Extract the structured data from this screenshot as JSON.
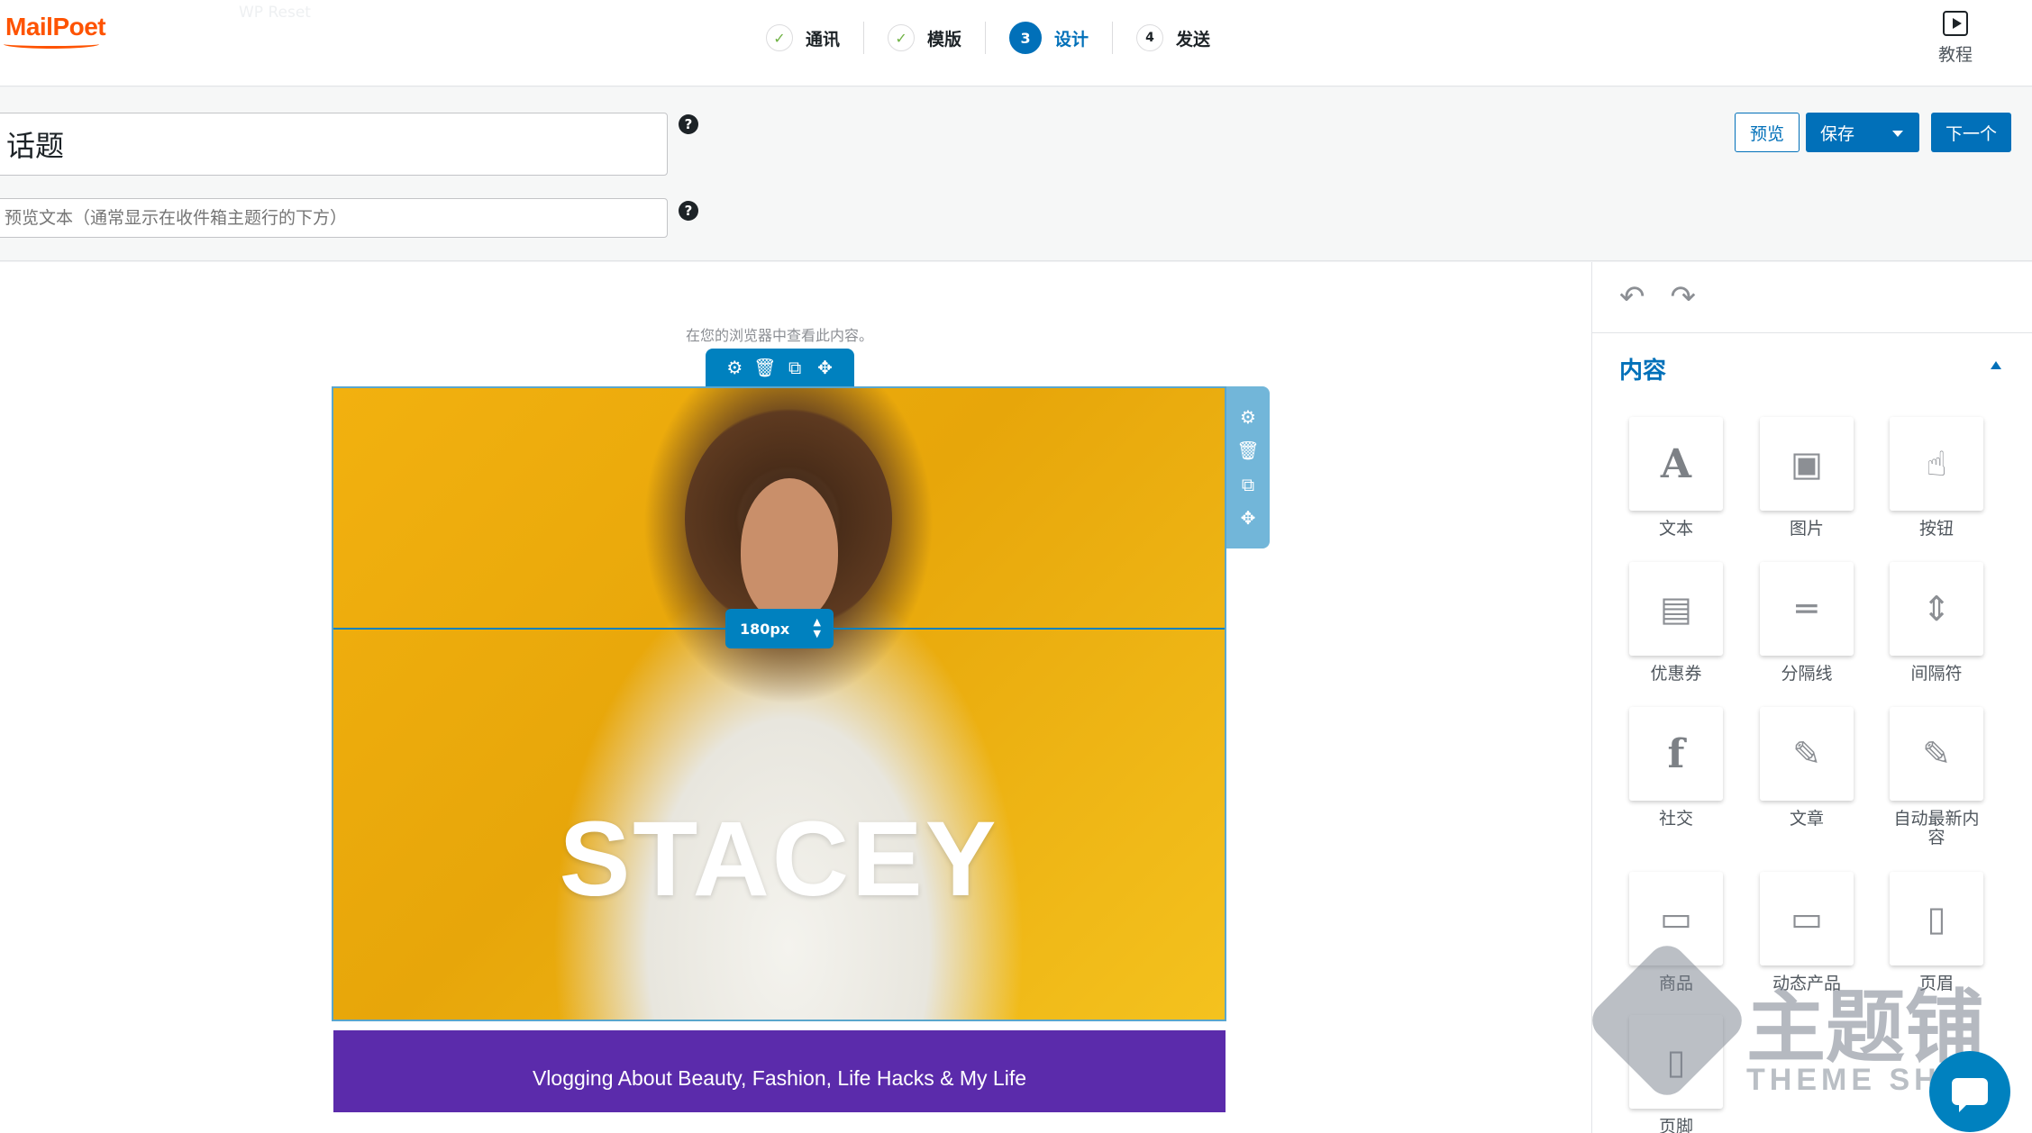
{
  "header": {
    "logo": "MailPoet",
    "ghost_text": "WP Reset",
    "steps": [
      {
        "label": "通讯",
        "state": "done",
        "marker": "✓"
      },
      {
        "label": "模版",
        "state": "done",
        "marker": "✓"
      },
      {
        "label": "设计",
        "state": "active",
        "marker": "3"
      },
      {
        "label": "发送",
        "state": "pending",
        "marker": "4"
      }
    ],
    "tutorial_label": "教程"
  },
  "subject": {
    "subject_value": "话题",
    "preheader_placeholder": "预览文本（通常显示在收件箱主题行的下方）",
    "help_glyph": "?"
  },
  "actions": {
    "preview": "预览",
    "save": "保存",
    "next": "下一个"
  },
  "canvas": {
    "view_in_browser": "在您的浏览器中查看此内容。",
    "height_value": "180px",
    "hero_title": "STACEY",
    "footer_text": "Vlogging About Beauty, Fashion, Life Hacks & My Life",
    "block_tools": [
      "gear-icon",
      "trash-icon",
      "duplicate-icon",
      "move-icon"
    ],
    "footer_color": "#5b2bab",
    "accent_color": "#0081bf"
  },
  "sidebar": {
    "undo": "↶",
    "redo": "↷",
    "panel_title": "内容",
    "widgets": [
      {
        "label": "文本",
        "glyph": "A",
        "icon": "text-icon"
      },
      {
        "label": "图片",
        "glyph": "▣",
        "icon": "image-icon"
      },
      {
        "label": "按钮",
        "glyph": "☝",
        "icon": "button-icon"
      },
      {
        "label": "优惠券",
        "glyph": "▤",
        "icon": "coupon-icon"
      },
      {
        "label": "分隔线",
        "glyph": "═",
        "icon": "divider-icon"
      },
      {
        "label": "间隔符",
        "glyph": "⇕",
        "icon": "spacer-icon"
      },
      {
        "label": "社交",
        "glyph": "f",
        "icon": "social-icon"
      },
      {
        "label": "文章",
        "glyph": "✎",
        "icon": "post-icon"
      },
      {
        "label": "自动最新内容",
        "glyph": "✎",
        "icon": "auto-latest-icon"
      },
      {
        "label": "商品",
        "glyph": "▭",
        "icon": "product-icon"
      },
      {
        "label": "动态产品",
        "glyph": "▭",
        "icon": "dynamic-product-icon"
      },
      {
        "label": "页眉",
        "glyph": "▯",
        "icon": "header-icon"
      },
      {
        "label": "页脚",
        "glyph": "▯",
        "icon": "footer-icon"
      }
    ]
  },
  "watermark": {
    "main": "主题铺",
    "sub": "THEME SHOP"
  }
}
